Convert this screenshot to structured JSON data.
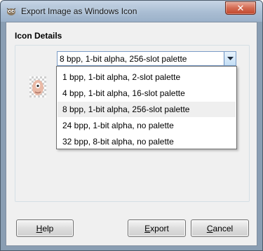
{
  "window": {
    "title": "Export Image as Windows Icon",
    "close_label": "✕"
  },
  "section": {
    "title": "Icon Details"
  },
  "combo": {
    "selected": "8 bpp, 1-bit alpha, 256-slot palette",
    "options": [
      "1 bpp, 1-bit alpha, 2-slot palette",
      "4 bpp, 1-bit alpha, 16-slot palette",
      "8 bpp, 1-bit alpha, 256-slot palette",
      "24 bpp, 1-bit alpha, no palette",
      "32 bpp, 8-bit alpha, no palette"
    ],
    "highlighted_index": 2
  },
  "buttons": {
    "help_first": "H",
    "help_rest": "elp",
    "export_first": "E",
    "export_rest": "xport",
    "cancel_first": "C",
    "cancel_rest": "ancel"
  },
  "icons": {
    "app": "gimp-icon",
    "thumbnail": "icon-preview-thumbnail",
    "dropdown": "chevron-down-icon"
  }
}
